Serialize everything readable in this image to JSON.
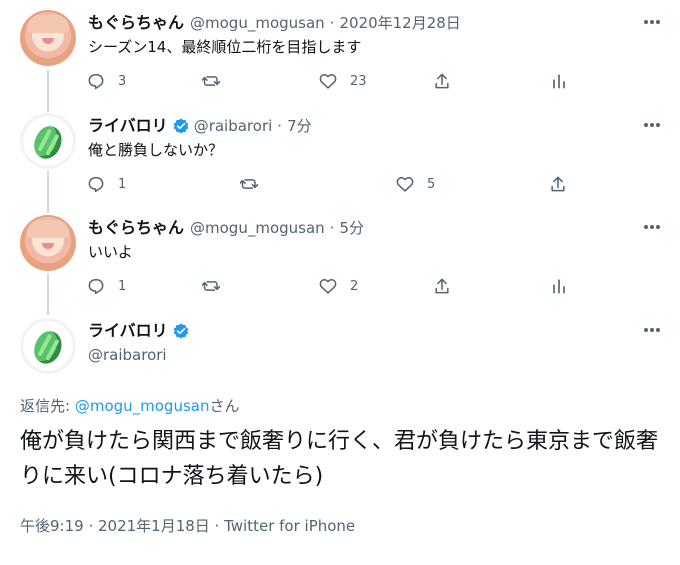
{
  "tweets": [
    {
      "name": "もぐらちゃん",
      "handle": "@mogu_mogusan",
      "time": "2020年12月28日",
      "text": "シーズン14、最終順位二桁を目指します",
      "reply_count": "3",
      "like_count": "23"
    },
    {
      "name": "ライバロリ",
      "handle": "@raibarori",
      "time": "7分",
      "text": "俺と勝負しないか？",
      "reply_count": "1",
      "like_count": "5"
    },
    {
      "name": "もぐらちゃん",
      "handle": "@mogu_mogusan",
      "time": "5分",
      "text": "いいよ",
      "reply_count": "1",
      "like_count": "2"
    }
  ],
  "main_tweet": {
    "name": "ライバロリ",
    "handle": "@raibarori",
    "reply_prefix": "返信先: ",
    "reply_handle": "@mogu_mogusan",
    "reply_suffix": "さん",
    "text": "俺が負けたら関西まで飯奢りに行く、君が負けたら東京まで飯奢りに来い(コロナ落ち着いたら)",
    "timestamp": "午後9:19 · 2021年1月18日 · Twitter for iPhone"
  },
  "icons": {
    "reply": "reply-icon",
    "retweet": "retweet-icon",
    "like": "like-icon",
    "share": "share-icon",
    "analytics": "analytics-icon",
    "more": "more-icon",
    "verified": "verified-badge-icon"
  },
  "colors": {
    "text": "#0f1419",
    "secondary": "#536471",
    "link": "#1d9bf0",
    "verified": "#1d9bf0",
    "thread_line": "#cfd9de"
  }
}
